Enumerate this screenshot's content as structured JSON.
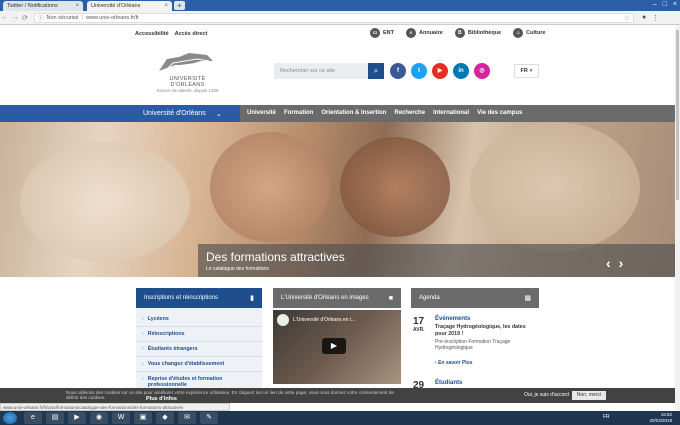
{
  "browser": {
    "tabs": [
      {
        "label": "Twitter / Notifications"
      },
      {
        "label": "Université d'Orléans"
      }
    ],
    "address": {
      "security": "Non sécurisé",
      "url": "www.univ-orleans.fr/fr"
    },
    "status_url": "www.univ-orleans.fr/fr/univ/formations/catalogue-des-formations/des-formations-attractives"
  },
  "util": {
    "left_links": [
      "Accessibilité",
      "Accès direct"
    ],
    "right_links": [
      {
        "label": "ENT",
        "icon": "monitor-icon"
      },
      {
        "label": "Annuaire",
        "icon": "search-icon"
      },
      {
        "label": "Bibliothèque",
        "icon": "book-icon"
      },
      {
        "label": "Culture",
        "icon": "theater-icon"
      }
    ]
  },
  "header": {
    "logo_name": "UNIVERSITÉ D'ORLÉANS",
    "logo_tag": "Source de talents, depuis 1306",
    "search_placeholder": "Rechercher sur ce site",
    "socials": [
      {
        "name": "facebook",
        "glyph": "f",
        "color": "#3b5998"
      },
      {
        "name": "twitter",
        "glyph": "t",
        "color": "#1da1f2"
      },
      {
        "name": "youtube",
        "glyph": "▶",
        "color": "#e52d27"
      },
      {
        "name": "linkedin",
        "glyph": "in",
        "color": "#0077b5"
      },
      {
        "name": "instagram",
        "glyph": "◎",
        "color": "#d6249f"
      }
    ],
    "lang": "FR"
  },
  "nav": {
    "university": "Université d'Orléans",
    "items": [
      "Université",
      "Formation",
      "Orientation & Insertion",
      "Recherche",
      "International",
      "Vie des campus"
    ],
    "active_index": 4
  },
  "hero": {
    "title": "Des formations attractives",
    "subtitle": "Le catalogue des formations"
  },
  "panels": {
    "inscriptions": {
      "title": "Inscriptions et réinscriptions",
      "items": [
        "Lycéens",
        "Réinscriptions",
        "Étudiants étrangers",
        "Vous changez d'établissement",
        "Reprise d'études et formation professionnelle"
      ]
    },
    "video": {
      "title": "L'Université d'Orléans en images",
      "video_title": "L'Université d'Orléans en i..."
    },
    "agenda": {
      "title": "Agenda",
      "events": [
        {
          "day": "17",
          "month": "AVR.",
          "category": "Événements",
          "title": "Traçage Hydrogéologique, les dates pour 2019 !",
          "desc": "Pré-inscription Formation Traçage Hydrogéologique",
          "more": "En savoir Plus"
        },
        {
          "day": "29",
          "category": "Étudiants"
        }
      ]
    }
  },
  "cookie": {
    "text": "Nous utilisons des cookies sur ce site pour améliorer votre expérience utilisateur. En cliquant sur un lien de cette page, vous nous donnez votre consentement de définir des cookies.",
    "accept": "Oui, je suis d'accord",
    "decline": "Non, merci",
    "more": "Plus d'infos"
  },
  "taskbar": {
    "lang": "FR",
    "time": "15:52",
    "date": "20/03/2019"
  }
}
